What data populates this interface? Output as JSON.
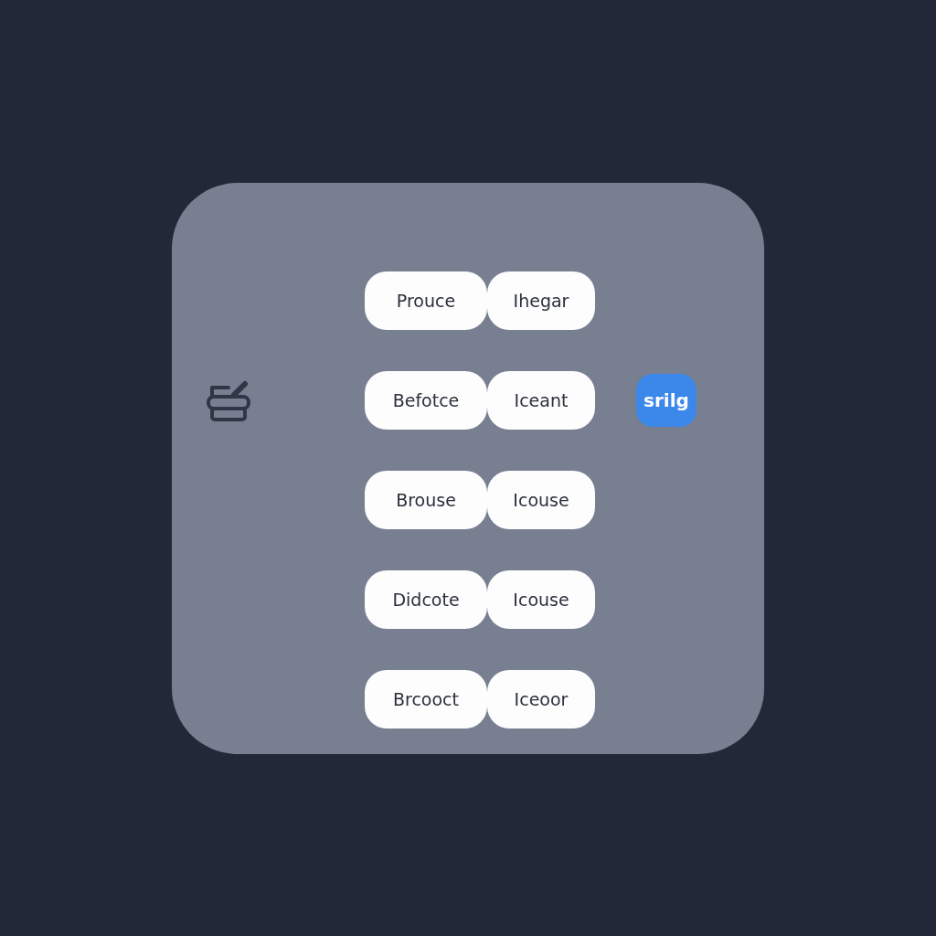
{
  "left_column": [
    "Prouce",
    "Befotce",
    "Brouse",
    "Didcote",
    "Brcooct"
  ],
  "right_column": [
    "Ihegar",
    "Iceant",
    "Icouse",
    "Icouse",
    "Iceoor"
  ],
  "side_button": {
    "label": "srilg"
  }
}
